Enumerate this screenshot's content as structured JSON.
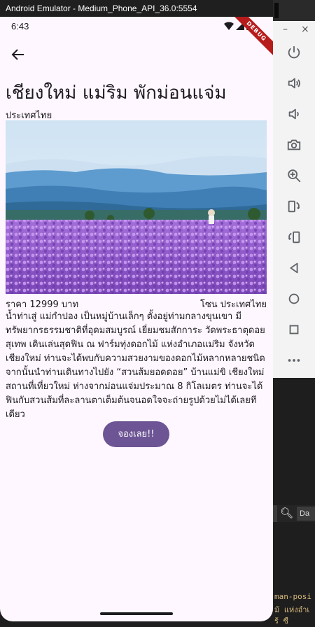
{
  "window": {
    "title": "Android Emulator - Medium_Phone_API_36.0:5554"
  },
  "emulator_panel": {
    "minimize": "–",
    "close": "×",
    "controls": [
      "power-icon",
      "volume-up-icon",
      "volume-down-icon",
      "camera-icon",
      "zoom-icon",
      "rotate-left-icon",
      "rotate-right-icon",
      "back-icon",
      "home-icon",
      "overview-icon",
      "more-icon"
    ]
  },
  "statusbar": {
    "time": "6:43"
  },
  "debug_banner": "DEBUG",
  "detail": {
    "title": "เชียงใหม่ แม่ริม พักม่อนแจ่ม",
    "country": "ประเทศไทย",
    "price": "ราคา 12999 บาท",
    "location": "โซน ประเทศไทย",
    "description": "น้ำท่าเสู่ แม่กำปอง เป็นหมู่บ้านเล็กๆ ตั้งอยู่ท่ามกลางขุนเขา มีทรัพยากรธรรมชาติที่อุดมสมบูรณ์ เยี่ยมชมสักการะ วัดพระธาตุดอยสุเทพ เดินเล่นสุดฟิน ณ ฟาร์มทุ่งดอกไม้ แห่งอำเภอแม่ริม จังหวัดเชียงใหม่ ท่านจะได้พบกับความสวยงามของดอกไม้หลากหลายชนิด จากนั้นนำท่านเดินทางไปยัง “สวนส้มยอดดอย” บ้านแม่ขิ เชียงใหม่ สถานที่เที่ยวใหม่ ห่างจากม่อนแจ่มประมาณ 8 กิโลเมตร ท่านจะได้ฟินกับสวนส้มที่ละลานตาเต็มต้นจนอดใจจะถ่ายรูปด้วยไม่ได้เลยทีเดียว",
    "book_label": "จองเลย!!"
  },
  "editor": {
    "search_dropdown": "Da",
    "code_lines": [
      "man-posi",
      "ม้ แห่งอำเ",
      "ร้ ซื"
    ]
  },
  "colors": {
    "accent": "#6d5494",
    "background": "#fef7ff",
    "debug": "#b71c1c"
  }
}
